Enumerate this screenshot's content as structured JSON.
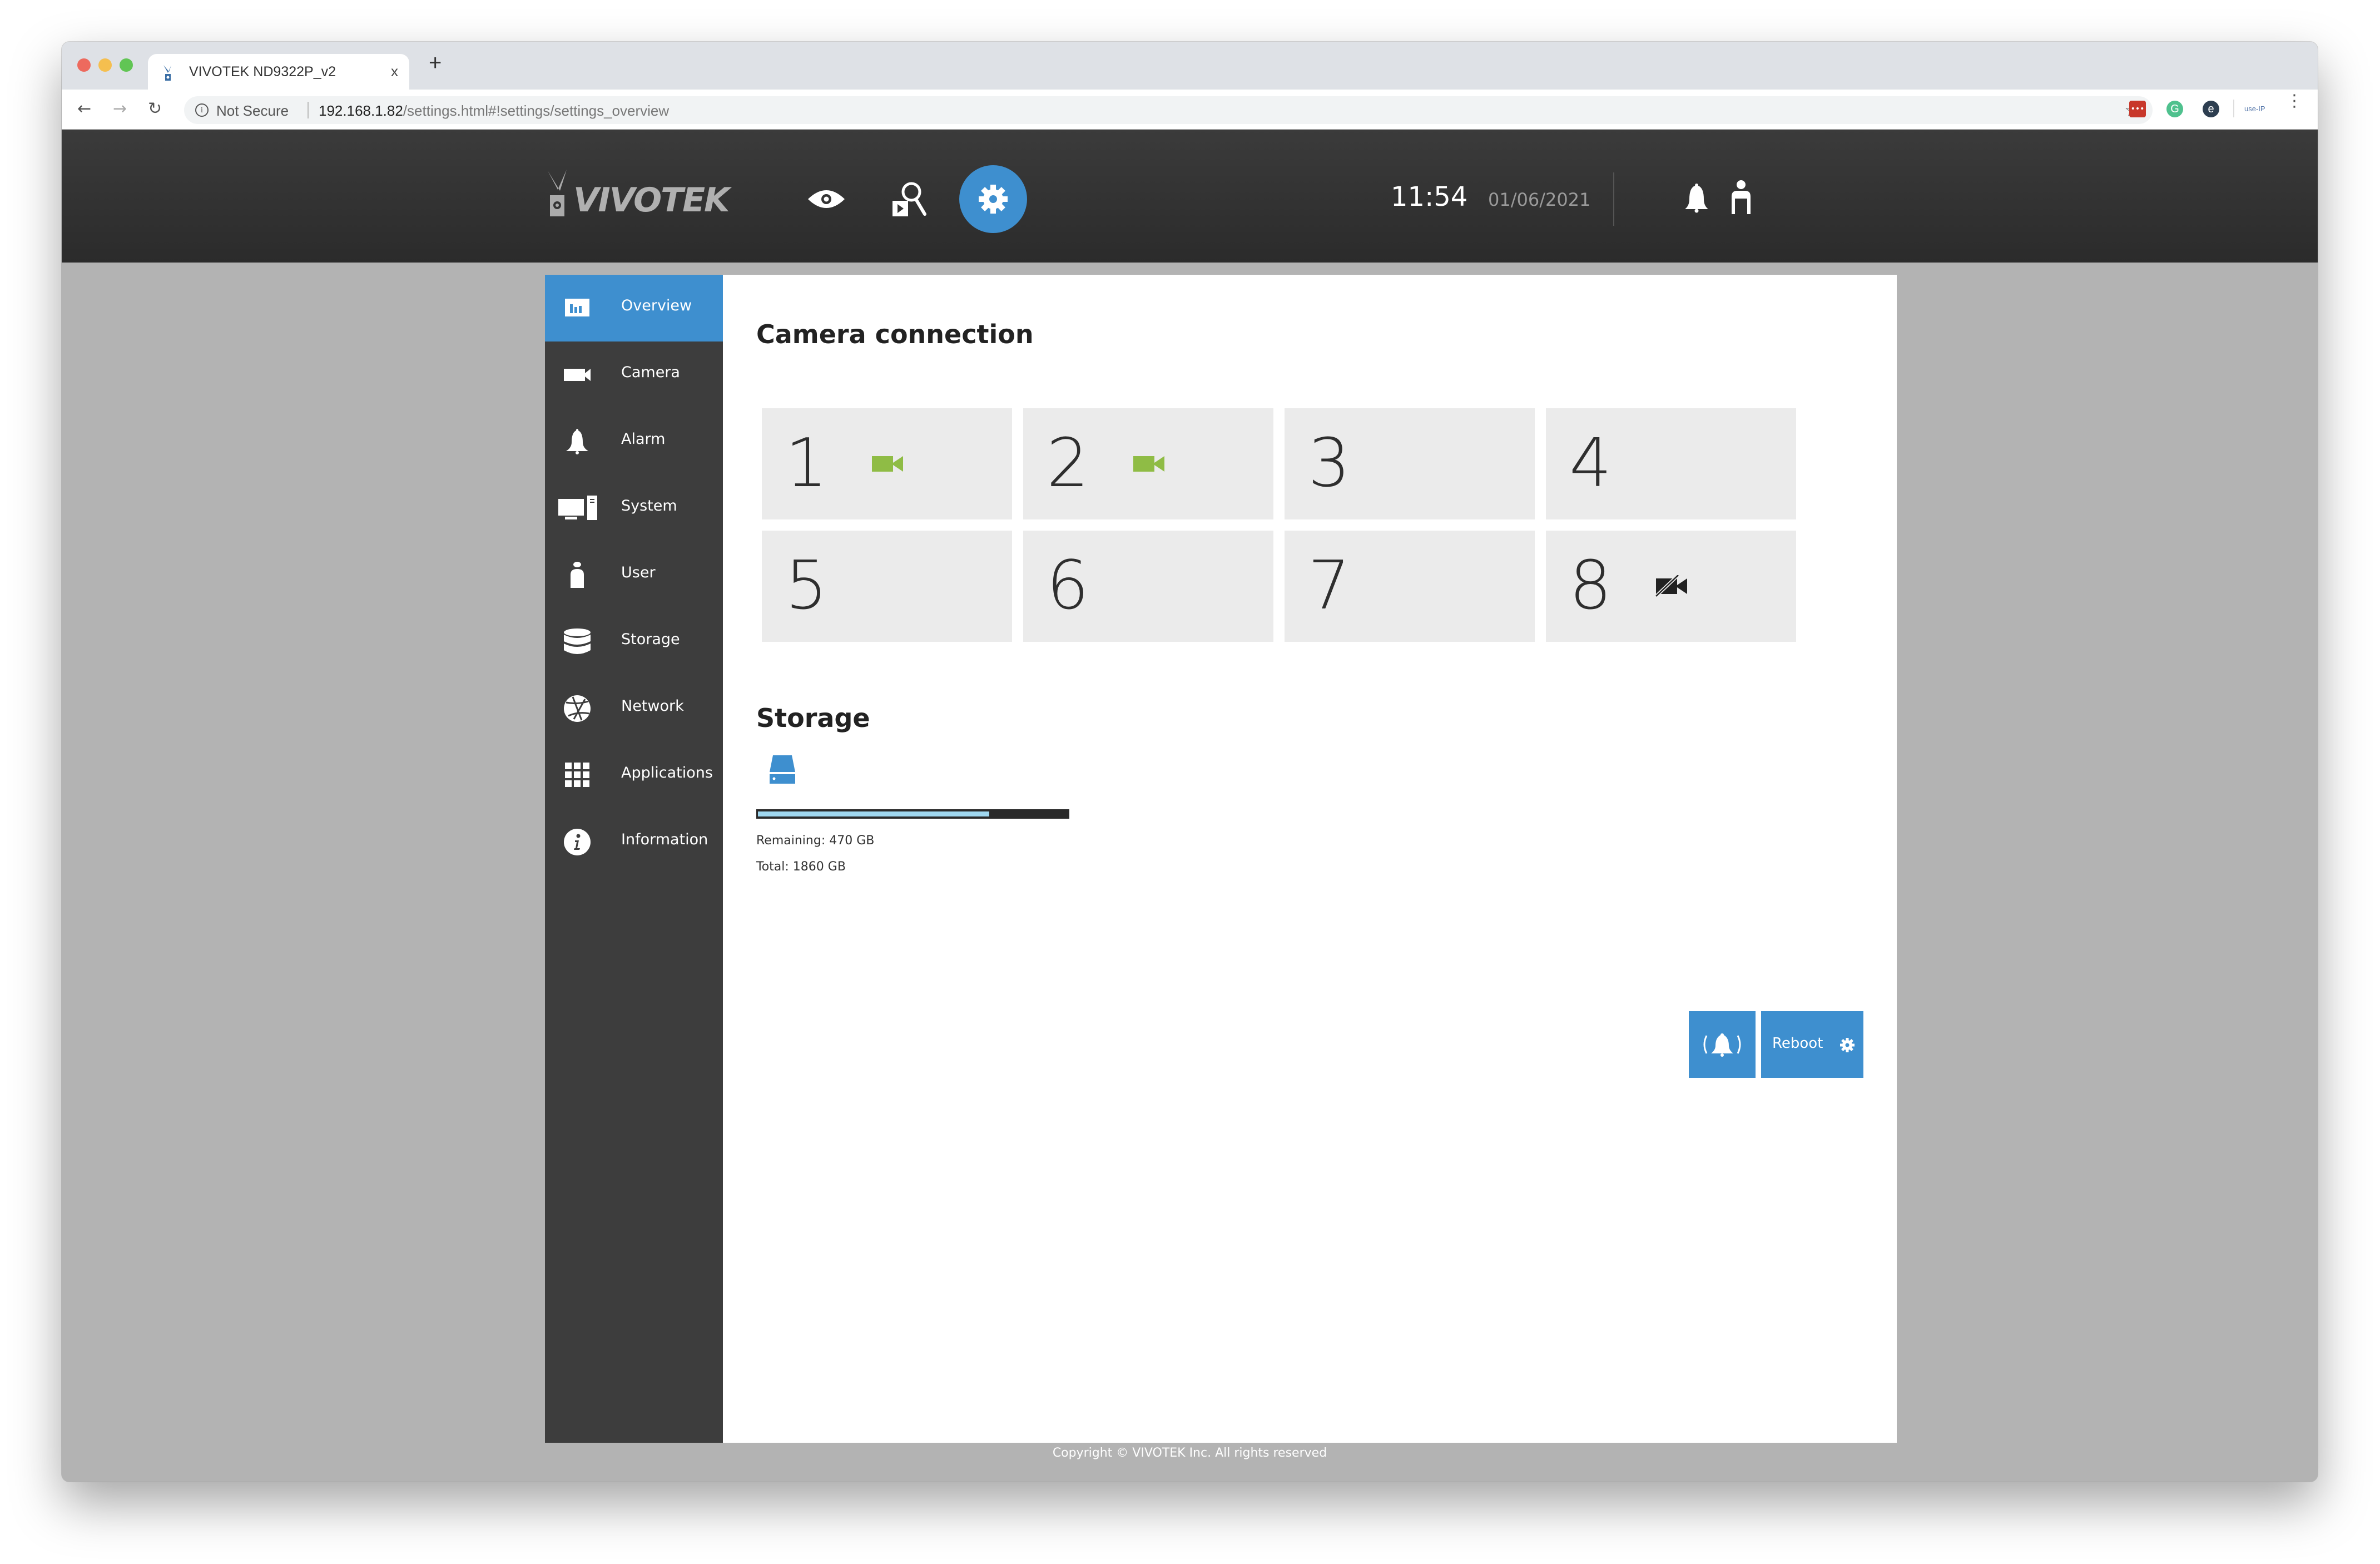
{
  "browser": {
    "tab_title": "VIVOTEK ND9322P_v2",
    "tab_close": "x",
    "new_tab": "+",
    "security_label": "Not Secure",
    "url_host": "192.168.1.82",
    "url_path": "/settings.html#!settings/settings_overview",
    "extensions": [
      "lastpass-icon",
      "grammarly-icon",
      "e-extension-icon",
      "useip-icon"
    ],
    "useip_label": "use-IP"
  },
  "header": {
    "brand": "VIVOTEK",
    "nav": [
      {
        "name": "live-view",
        "icon": "eye-icon",
        "active": false
      },
      {
        "name": "playback",
        "icon": "playback-search-icon",
        "active": false
      },
      {
        "name": "settings",
        "icon": "gear-icon",
        "active": true
      }
    ],
    "time": "11:54",
    "date": "01/06/2021",
    "accent_color": "#3e8fcf"
  },
  "sidebar": {
    "items": [
      {
        "label": "Overview",
        "icon": "overview-chart-icon",
        "active": true
      },
      {
        "label": "Camera",
        "icon": "camera-icon",
        "active": false
      },
      {
        "label": "Alarm",
        "icon": "bell-icon",
        "active": false
      },
      {
        "label": "System",
        "icon": "computer-icon",
        "active": false
      },
      {
        "label": "User",
        "icon": "user-icon",
        "active": false
      },
      {
        "label": "Storage",
        "icon": "database-icon",
        "active": false
      },
      {
        "label": "Network",
        "icon": "globe-icon",
        "active": false
      },
      {
        "label": "Applications",
        "icon": "grid-icon",
        "active": false
      },
      {
        "label": "Information",
        "icon": "info-icon",
        "active": false
      }
    ]
  },
  "main": {
    "camera_section_title": "Camera connection",
    "cameras": [
      {
        "number": "1",
        "status": "connected"
      },
      {
        "number": "2",
        "status": "connected"
      },
      {
        "number": "3",
        "status": "empty"
      },
      {
        "number": "4",
        "status": "empty"
      },
      {
        "number": "5",
        "status": "empty"
      },
      {
        "number": "6",
        "status": "empty"
      },
      {
        "number": "7",
        "status": "empty"
      },
      {
        "number": "8",
        "status": "disconnected"
      }
    ],
    "status_colors": {
      "connected": "#8fbc45",
      "disconnected": "#222222"
    },
    "storage_section_title": "Storage",
    "storage": {
      "remaining_label": "Remaining: 470 GB",
      "total_label": "Total: 1860 GB",
      "remaining_gb": 470,
      "total_gb": 1860,
      "used_fraction": 0.747
    },
    "alarm_button_icon": "ringing-bell-icon",
    "reboot_label": "Reboot"
  },
  "footer": {
    "copyright": "Copyright © VIVOTEK Inc. All rights reserved"
  }
}
